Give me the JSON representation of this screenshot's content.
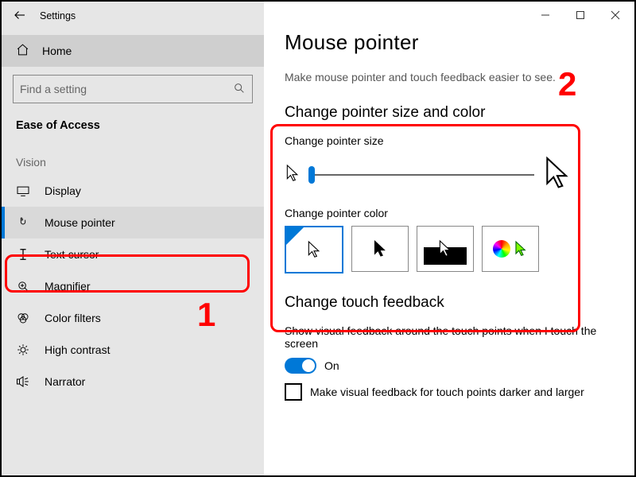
{
  "window": {
    "app_title": "Settings",
    "home_label": "Home",
    "search_placeholder": "Find a setting",
    "category": "Ease of Access",
    "subcategory": "Vision",
    "nav": [
      {
        "key": "display",
        "label": "Display"
      },
      {
        "key": "mouse-pointer",
        "label": "Mouse pointer"
      },
      {
        "key": "text-cursor",
        "label": "Text cursor"
      },
      {
        "key": "magnifier",
        "label": "Magnifier"
      },
      {
        "key": "color-filters",
        "label": "Color filters"
      },
      {
        "key": "high-contrast",
        "label": "High contrast"
      },
      {
        "key": "narrator",
        "label": "Narrator"
      }
    ],
    "active_nav": "mouse-pointer"
  },
  "page": {
    "title": "Mouse pointer",
    "subtitle": "Make mouse pointer and touch feedback easier to see.",
    "section_size_color": "Change pointer size and color",
    "pointer_size_label": "Change pointer size",
    "pointer_color_label": "Change pointer color",
    "pointer_color_selected": 0,
    "section_touch": "Change touch feedback",
    "touch_desc": "Show visual feedback around the touch points when I touch the screen",
    "touch_toggle_label": "On",
    "touch_toggle_on": true,
    "darker_checkbox_label": "Make visual feedback for touch points darker and larger",
    "darker_checked": false
  },
  "annotations": {
    "one": "1",
    "two": "2"
  },
  "colors": {
    "accent": "#0078d7",
    "annotation": "#ff0000"
  }
}
